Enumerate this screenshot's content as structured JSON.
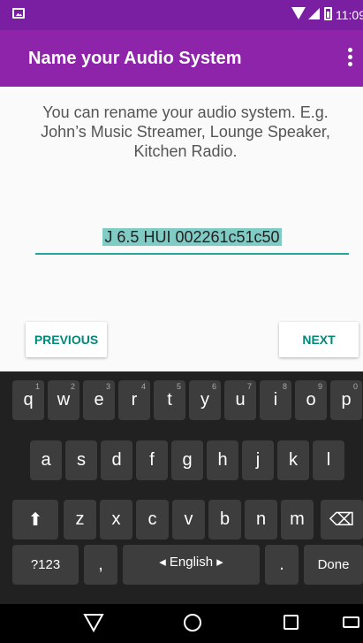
{
  "status": {
    "time": "11:09"
  },
  "appbar": {
    "title": "Name your Audio System"
  },
  "content": {
    "instructions": "You can rename your audio system. E.g. John’s Music Streamer, Lounge Speaker, Kitchen Radio.",
    "system_name": "J 6.5 HUI 002261c51c50",
    "previous_label": "PREVIOUS",
    "next_label": "NEXT"
  },
  "keyboard": {
    "row1": [
      {
        "k": "q",
        "h": "1"
      },
      {
        "k": "w",
        "h": "2"
      },
      {
        "k": "e",
        "h": "3"
      },
      {
        "k": "r",
        "h": "4"
      },
      {
        "k": "t",
        "h": "5"
      },
      {
        "k": "y",
        "h": "6"
      },
      {
        "k": "u",
        "h": "7"
      },
      {
        "k": "i",
        "h": "8"
      },
      {
        "k": "o",
        "h": "9"
      },
      {
        "k": "p",
        "h": "0"
      }
    ],
    "row2": [
      "a",
      "s",
      "d",
      "f",
      "g",
      "h",
      "j",
      "k",
      "l"
    ],
    "row3": [
      "z",
      "x",
      "c",
      "v",
      "b",
      "n",
      "m"
    ],
    "symbols_label": "?123",
    "comma_label": ",",
    "space_label": "◂ English ▸",
    "period_label": ".",
    "done_label": "Done",
    "shift_label": "⬆",
    "delete_label": "⌫"
  },
  "colors": {
    "status_bar": "#7b1fa2",
    "app_bar": "#8e24aa",
    "accent": "#26a69a",
    "button_text": "#00897b"
  }
}
